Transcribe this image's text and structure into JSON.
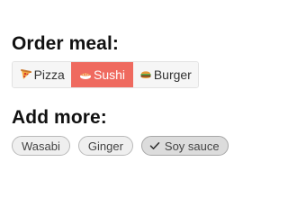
{
  "order": {
    "title": "Order meal:",
    "options": [
      {
        "label": "Pizza",
        "icon": "pizza-icon",
        "selected": false
      },
      {
        "label": "Sushi",
        "icon": "sushi-icon",
        "selected": true
      },
      {
        "label": "Burger",
        "icon": "burger-icon",
        "selected": false
      }
    ]
  },
  "addons": {
    "title": "Add more:",
    "chips": [
      {
        "label": "Wasabi",
        "checked": false
      },
      {
        "label": "Ginger",
        "checked": false
      },
      {
        "label": "Soy sauce",
        "checked": true,
        "icon": "checkmark-icon"
      }
    ]
  },
  "colors": {
    "selected_segment": "#ef6a5f",
    "chip_background": "#efefef",
    "chip_checked_background": "#dcdcdc"
  }
}
